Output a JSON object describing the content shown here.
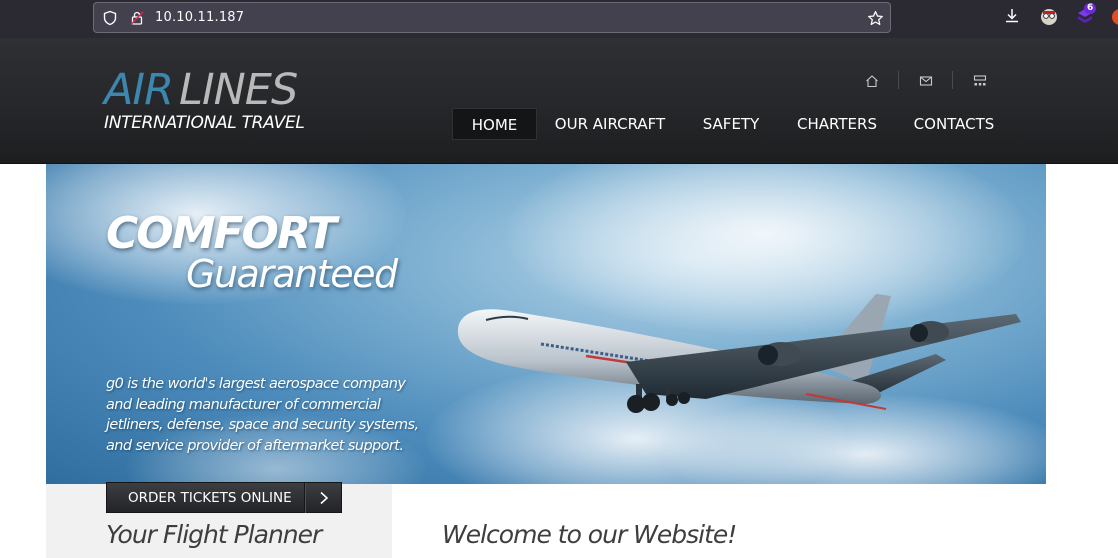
{
  "browser": {
    "url": "10.10.11.187",
    "extension_badge": "6",
    "icons": [
      "shield-icon",
      "lock-icon",
      "bookmark-star-icon",
      "download-icon",
      "profile-icon",
      "extension-icon",
      "menu-partial-icon"
    ]
  },
  "header": {
    "logo": {
      "air": "AIR",
      "lines": "LINES",
      "subtitle": "INTERNATIONAL TRAVEL"
    },
    "utility_icons": [
      "home-icon",
      "mail-icon",
      "sitemap-icon"
    ],
    "nav": [
      {
        "label": "HOME",
        "active": true
      },
      {
        "label": "OUR AIRCRAFT",
        "active": false
      },
      {
        "label": "SAFETY",
        "active": false
      },
      {
        "label": "CHARTERS",
        "active": false
      },
      {
        "label": "CONTACTS",
        "active": false
      }
    ]
  },
  "hero": {
    "title": "COMFORT",
    "subtitle": "Guaranteed",
    "description": "g0 is the world's largest aerospace company and leading manufacturer of commercial jetliners, defense, space and security systems, and service provider of aftermarket support."
  },
  "order": {
    "label": "ORDER TICKETS ONLINE"
  },
  "planner": {
    "title": "Your Flight Planner"
  },
  "welcome": {
    "title": "Welcome to our Website!"
  },
  "colors": {
    "browser_chrome": "#2b2a33",
    "url_field": "#42414d",
    "header_bg": "#26272a",
    "logo_accent": "#3d86ad",
    "nav_active_bg": "#141517",
    "sky": "#4c8bbb"
  }
}
